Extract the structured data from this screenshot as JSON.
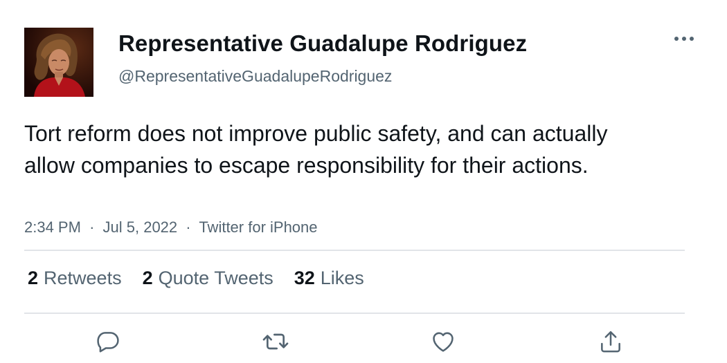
{
  "user": {
    "display_name": "Representative Guadalupe Rodriguez",
    "handle": "@RepresentativeGuadalupeRodriguez",
    "avatar_icon": "profile-photo"
  },
  "tweet": {
    "text": "Tort reform does not improve public safety, and can actually allow companies to escape responsibility for their actions.",
    "time": "2:34 PM",
    "date": "Jul 5, 2022",
    "source": "Twitter for iPhone",
    "separator": "·"
  },
  "stats": [
    {
      "count": "2",
      "label": "Retweets"
    },
    {
      "count": "2",
      "label": "Quote Tweets"
    },
    {
      "count": "32",
      "label": "Likes"
    }
  ],
  "actions": {
    "reply_icon": "reply-icon",
    "retweet_icon": "retweet-icon",
    "like_icon": "heart-icon",
    "share_icon": "share-icon"
  },
  "colors": {
    "text_primary": "#0f1419",
    "text_secondary": "#536471",
    "divider": "#e1e4e8",
    "icon": "#536471"
  }
}
